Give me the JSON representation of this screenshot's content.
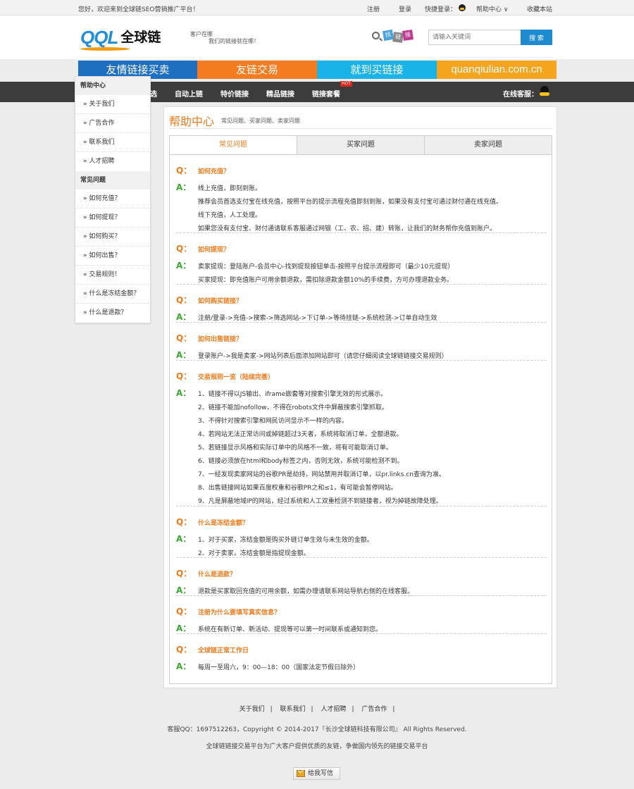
{
  "topbar": {
    "welcome": "您好，欢迎来到全球链SEO营销推广平台！",
    "register": "注册",
    "login": "登录",
    "quick_login": "快捷登录：",
    "help_center": "帮助中心 ∨",
    "bookmark": "收藏本站"
  },
  "header": {
    "logo_latin": "QQL",
    "logo_cn": "全球链",
    "slogan_line1": "客户在哪",
    "slogan_line2": "我们的链接就在哪！",
    "find_icon_chars": [
      "找",
      "链",
      "接"
    ],
    "search_placeholder": "请输入关键词",
    "search_button": "搜 索"
  },
  "banner": [
    "友情链接买卖",
    "友链交易",
    "就到买链接",
    "quanqiulian.com.cn"
  ],
  "nav": {
    "items": [
      "选",
      "自动上链",
      "特价链接",
      "精品链接",
      "链接套餐"
    ],
    "hot_badge": "HOT",
    "online_service": "在线客服："
  },
  "sidebar": {
    "section1_title": "帮助中心",
    "section1_items": [
      "» 关于我们",
      "» 广告合作",
      "» 联系我们",
      "» 人才招聘"
    ],
    "section2_title": "常见问题",
    "section2_items": [
      "» 如何充值？",
      "» 如何提现？",
      "» 如何购买？",
      "» 如何出售？",
      "» 交易规则！",
      "» 什么是冻结金额？",
      "» 什么是退款？"
    ]
  },
  "main": {
    "title": "帮助中心",
    "subtitle": "常见问题、买家问题、卖家问题",
    "tabs": [
      "常见问题",
      "买家问题",
      "卖家问题"
    ],
    "q_marker": "Q：",
    "a_marker": "A：",
    "faqs": [
      {
        "q": "如何充值？",
        "a": [
          "线上充值，即刻到账。",
          "推荐会员首选支付宝在线充值，按照平台的提示流程充值即刻到账，如果没有支付宝可通过财付通在线充值。",
          "线下充值，人工处理。",
          "如果您没有支付宝、财付通请联系客服通过网银（工、农、招、建）转账，让我们的财务帮你充值到账户。"
        ]
      },
      {
        "q": "如何提现？",
        "a": [
          "卖家提现：登陆账户-会员中心-找到提现按钮单击-按照平台提示流程即可（最少10元提现）",
          "买家提现：即充值账户可用余额退款，需扣除退款金额10%的手续费，方可办理退款业务。"
        ]
      },
      {
        "q": "如何购买链接？",
        "a": [
          "注册/登录->充值->搜索->筛选网站->下订单->等待挂链->系统检测->订单自动生效"
        ]
      },
      {
        "q": "如何出售链接？",
        "a": [
          "登录账户->我是卖家->网站列表后面添加网站即可（请您仔细阅读全球链链接交易规则）"
        ]
      },
      {
        "q": "交易规则一览（陆续完善）",
        "a": [
          "1、链接不得以JS输出、iframe嵌套等对搜索引擎无效的形式展示。",
          "2、链接不能加nofollow，不得在robots文件中屏蔽搜索引擎抓取。",
          "3、不得针对搜索引擎和网民访问显示不一样的内容。",
          "4、若网站无法正常访问或掉链超过3天者，系统将取消订单，全额退款。",
          "5、若链接显示风格和实际订单中的风格不一致，将有可能取消订单。",
          "6、链接必须放在html和body标签之内，否则无效，系统可能检测不到。",
          "7、一经发现卖家网站的谷歌PR是劫持，网站禁用并取消订单，以pr.links.cn查询为准。",
          "8、出售链接网站如果百度权重和谷歌PR之和≤1，有可能会暂停网站。",
          "9、凡是屏蔽地域IP的网站，经过系统和人工双重检测不到链接者，视为掉链故障处理。"
        ]
      },
      {
        "q": "什么是冻结金额？",
        "a": [
          "1、对于买家，冻结金额是购买外链订单生效与未生效的金额。",
          "2、对于卖家，冻结金额是指提现金额。"
        ]
      },
      {
        "q": "什么是退款？",
        "a": [
          "退款是买家取回充值的可用余额，如需办理请联系网站导航右侧的在线客服。"
        ]
      },
      {
        "q": "注册为什么要填写真实信息？",
        "a": [
          "系统在有新订单、新活动、提现等可以第一时间联系或通知到您。"
        ]
      },
      {
        "q": "全球链正常工作日",
        "a": [
          "每周一至周六，9：00—18：00（国家法定节假日除外）"
        ]
      }
    ]
  },
  "footer": {
    "links": [
      "关于我们",
      "联系我们",
      "人才招聘",
      "广告合作"
    ],
    "separator": "|",
    "copyright": "客服QQ：1697512263，Copyright © 2014-2017『长沙全球链科技有限公司』 All Rights Reserved.",
    "slogan": "全球链链接交易平台为广大客户提供优质的友链，争做国内领先的链接交易平台",
    "mail_button": "给我写信"
  },
  "colors": {
    "accent_orange": "#f07a1a",
    "answer_green": "#3aa530",
    "search_blue": "#1e8bd1",
    "nav_dark": "#3c3c3c"
  }
}
